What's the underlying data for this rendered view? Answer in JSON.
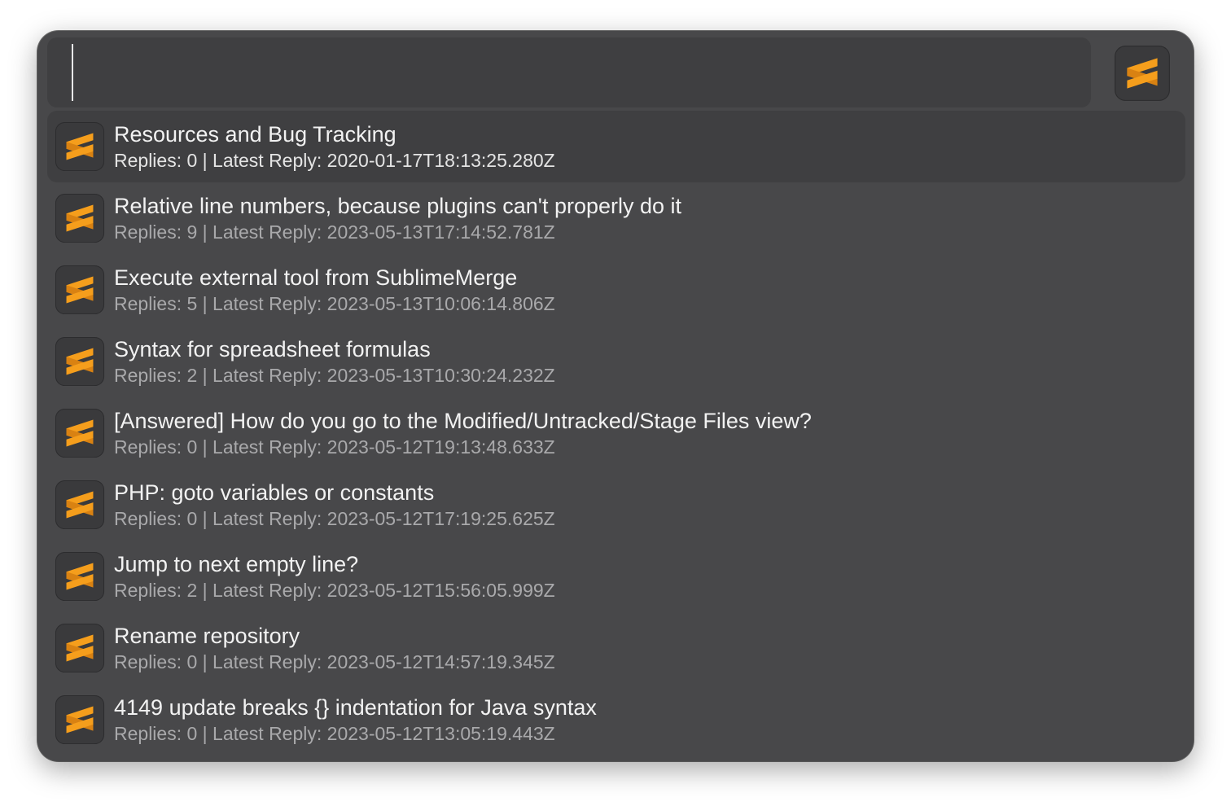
{
  "search": {
    "value": "",
    "placeholder": ""
  },
  "app_icon": "sublime-text-icon",
  "colors": {
    "window_bg": "#48484a",
    "selected_bg": "#3f3f41",
    "accent": "#f59e1c",
    "title_text": "#f2f2f2",
    "subtitle_text": "#a9a9ab"
  },
  "results": [
    {
      "title": "Resources and Bug Tracking",
      "subtitle": "Replies: 0 | Latest Reply: 2020-01-17T18:13:25.280Z",
      "icon": "sublime-text-icon",
      "selected": true
    },
    {
      "title": "Relative line numbers, because plugins can't properly do it",
      "subtitle": "Replies: 9 | Latest Reply: 2023-05-13T17:14:52.781Z",
      "icon": "sublime-text-icon",
      "selected": false
    },
    {
      "title": "Execute external tool from SublimeMerge",
      "subtitle": "Replies: 5 | Latest Reply: 2023-05-13T10:06:14.806Z",
      "icon": "sublime-text-icon",
      "selected": false
    },
    {
      "title": "Syntax for spreadsheet formulas",
      "subtitle": "Replies: 2 | Latest Reply: 2023-05-13T10:30:24.232Z",
      "icon": "sublime-text-icon",
      "selected": false
    },
    {
      "title": "[Answered] How do you go to the Modified/Untracked/Stage Files view?",
      "subtitle": "Replies: 0 | Latest Reply: 2023-05-12T19:13:48.633Z",
      "icon": "sublime-text-icon",
      "selected": false
    },
    {
      "title": "PHP: goto variables or constants",
      "subtitle": "Replies: 0 | Latest Reply: 2023-05-12T17:19:25.625Z",
      "icon": "sublime-text-icon",
      "selected": false
    },
    {
      "title": "Jump to next empty line?",
      "subtitle": "Replies: 2 | Latest Reply: 2023-05-12T15:56:05.999Z",
      "icon": "sublime-text-icon",
      "selected": false
    },
    {
      "title": "Rename repository",
      "subtitle": "Replies: 0 | Latest Reply: 2023-05-12T14:57:19.345Z",
      "icon": "sublime-text-icon",
      "selected": false
    },
    {
      "title": "4149 update breaks {} indentation for Java syntax",
      "subtitle": "Replies: 0 | Latest Reply: 2023-05-12T13:05:19.443Z",
      "icon": "sublime-text-icon",
      "selected": false
    }
  ]
}
